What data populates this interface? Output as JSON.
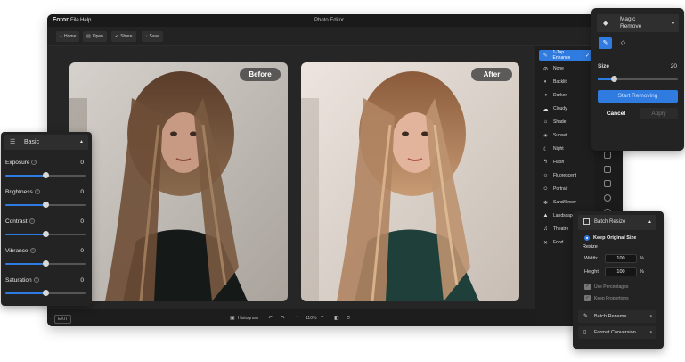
{
  "app": {
    "logo": "Fotor",
    "menu": [
      "File",
      "Help"
    ],
    "window_title": "Photo Editor",
    "toolbar": [
      {
        "icon": "home-icon",
        "label": "Home"
      },
      {
        "icon": "open-icon",
        "label": "Open"
      },
      {
        "icon": "share-icon",
        "label": "Share"
      },
      {
        "icon": "save-icon",
        "label": "Save"
      }
    ]
  },
  "canvas": {
    "before_label": "Before",
    "after_label": "After"
  },
  "statusbar": {
    "exit": "EXIT",
    "histogram": "Histogram",
    "zoom": "110%"
  },
  "enhance_list": [
    {
      "label": "1-Tap Enhance",
      "icon": "wand-icon",
      "active": true
    },
    {
      "label": "None",
      "icon": "none-icon"
    },
    {
      "label": "Backlit",
      "icon": "backlit-icon"
    },
    {
      "label": "Darken",
      "icon": "darken-icon"
    },
    {
      "label": "Cloudy",
      "icon": "cloudy-icon"
    },
    {
      "label": "Shade",
      "icon": "shade-icon"
    },
    {
      "label": "Sunset",
      "icon": "sunset-icon"
    },
    {
      "label": "Night",
      "icon": "night-icon"
    },
    {
      "label": "Flash",
      "icon": "flash-icon"
    },
    {
      "label": "Fluorescent",
      "icon": "fluorescent-icon"
    },
    {
      "label": "Portrait",
      "icon": "portrait-icon"
    },
    {
      "label": "Sand/Snow",
      "icon": "sand-snow-icon"
    },
    {
      "label": "Landscape",
      "icon": "landscape-icon"
    },
    {
      "label": "Theatre",
      "icon": "theatre-icon"
    },
    {
      "label": "Food",
      "icon": "food-icon"
    }
  ],
  "basic_panel": {
    "title": "Basic",
    "adjustments": [
      {
        "label": "Exposure",
        "value": "0",
        "level": 0.5
      },
      {
        "label": "Brightness",
        "value": "0",
        "level": 0.5
      },
      {
        "label": "Contrast",
        "value": "0",
        "level": 0.5
      },
      {
        "label": "Vibrance",
        "value": "0",
        "level": 0.5
      },
      {
        "label": "Saturation",
        "value": "0",
        "level": 0.5
      }
    ]
  },
  "magic_panel": {
    "title_line1": "Magic",
    "title_line2": "Remove",
    "size_label": "Size",
    "size_value": "20",
    "size_level": 0.2,
    "start_button": "Start Removing",
    "cancel_button": "Cancel",
    "apply_button": "Apply"
  },
  "batch_panel": {
    "title": "Batch Resize",
    "keep_original": "Keep Original Size",
    "resize": "Resize",
    "width_label": "Width:",
    "width_value": "100",
    "height_label": "Height:",
    "height_value": "100",
    "unit": "%",
    "use_percentages": "Use Percentages",
    "keep_proportions": "Keep Proportions",
    "batch_rename": "Batch Rename",
    "format_conversion": "Format Conversion"
  },
  "colors": {
    "accent": "#2f7be0",
    "panel": "#232323",
    "app_bg": "#1f1f1f"
  }
}
